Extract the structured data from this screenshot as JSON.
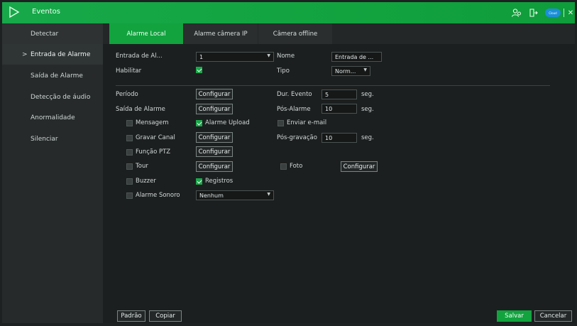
{
  "header": {
    "title": "Eventos",
    "icons": [
      "play-logo-icon",
      "users-icon",
      "logout-icon",
      "cloud-icon",
      "close-icon"
    ],
    "cloud_label": "Cloud"
  },
  "sidebar": {
    "items": [
      {
        "label": "Detectar"
      },
      {
        "label": "Entrada de Alarme",
        "chevron": ">"
      },
      {
        "label": "Saída de Alarme"
      },
      {
        "label": "Detecção de áudio"
      },
      {
        "label": "Anormalidade"
      },
      {
        "label": "Silenciar"
      }
    ]
  },
  "tabs": [
    {
      "label": "Alarme Local",
      "active": true
    },
    {
      "label": "Alarme câmera IP"
    },
    {
      "label": "Câmera offline"
    }
  ],
  "form": {
    "entrada_label": "Entrada de Al...",
    "entrada_value": "1",
    "nome_label": "Nome",
    "nome_value": "Entrada de ...",
    "habilitar_label": "Habilitar",
    "tipo_label": "Tipo",
    "tipo_value": "Norm...",
    "periodo_label": "Período",
    "configurar": "Configurar",
    "dur_evento_label": "Dur. Evento",
    "dur_evento_value": "5",
    "seg": "seg.",
    "saida_label": "Saída de Alarme",
    "pos_alarme_label": "Pós-Alarme",
    "pos_alarme_value": "10",
    "mensagem_label": "Mensagem",
    "alarme_upload_label": "Alarme Upload",
    "enviar_email_label": "Enviar e-mail",
    "gravar_canal_label": "Gravar Canal",
    "pos_gravacao_label": "Pós-gravação",
    "pos_gravacao_value": "10",
    "funcao_ptz_label": "Função PTZ",
    "tour_label": "Tour",
    "foto_label": "Foto",
    "buzzer_label": "Buzzer",
    "registros_label": "Registros",
    "alarme_sonoro_label": "Alarme Sonoro",
    "alarme_sonoro_value": "Nenhum"
  },
  "footer": {
    "padrao": "Padrão",
    "copiar": "Copiar",
    "salvar": "Salvar",
    "cancelar": "Cancelar"
  },
  "colors": {
    "accent": "#12a33f",
    "background": "#1c1f1f",
    "sidebar": "#262a2a"
  }
}
